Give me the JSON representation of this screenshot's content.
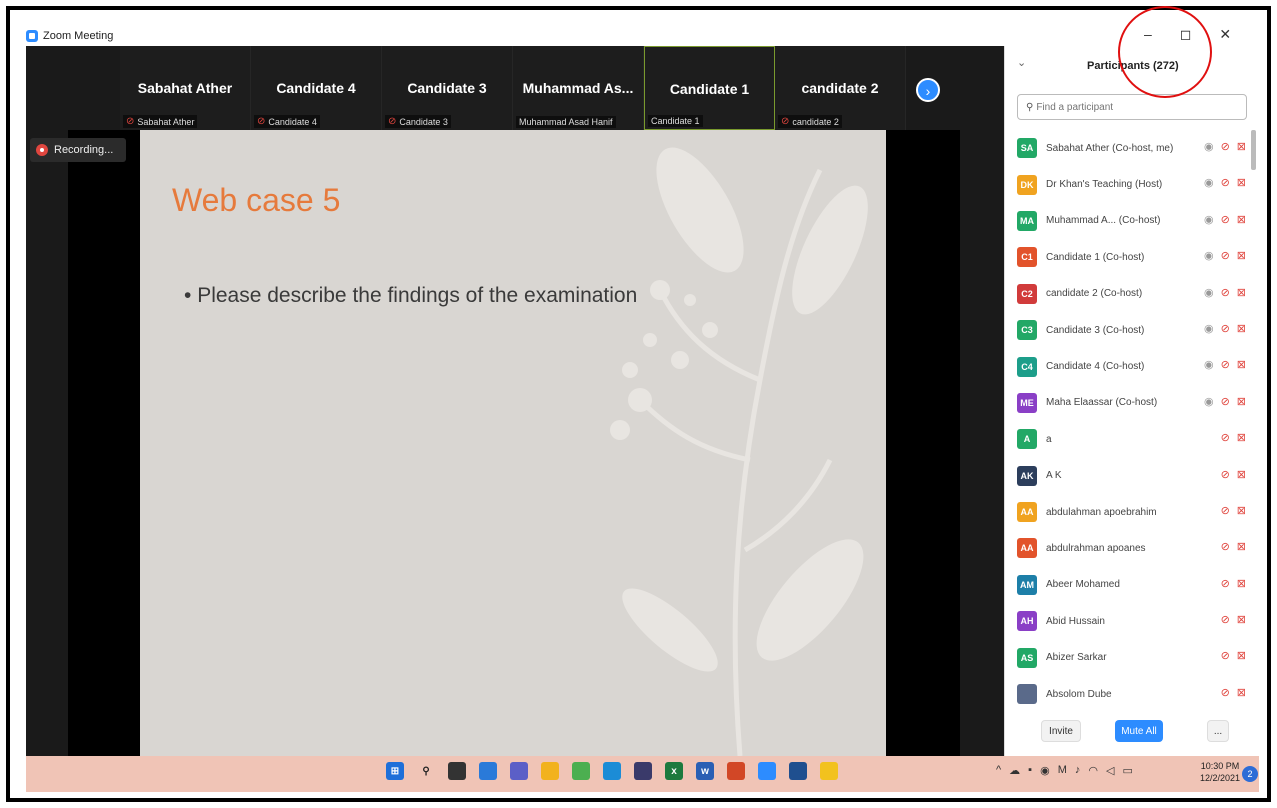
{
  "window": {
    "title": "Zoom Meeting",
    "controls": [
      "–",
      "◻",
      "✕"
    ]
  },
  "video_strip": {
    "tiles": [
      {
        "name": "Sabahat Ather",
        "sub": "Sabahat Ather",
        "muted": true
      },
      {
        "name": "Candidate 4",
        "sub": "Candidate 4",
        "muted": true
      },
      {
        "name": "Candidate 3",
        "sub": "Candidate 3",
        "muted": true
      },
      {
        "name": "Muhammad As...",
        "sub": "Muhammad Asad Hanif",
        "muted": false
      },
      {
        "name": "Candidate 1",
        "sub": "Candidate 1",
        "muted": false
      },
      {
        "name": "candidate 2",
        "sub": "candidate 2",
        "muted": true
      }
    ],
    "next_icon": "chevron-right-icon"
  },
  "recording": {
    "label": "Recording..."
  },
  "slide": {
    "title": "Web case 5",
    "bullet": "Please describe the findings of the examination"
  },
  "participants_panel": {
    "title": "Participants (272)",
    "search_placeholder": "Find a participant",
    "participants": [
      {
        "initials": "SA",
        "name": "Sabahat Ather (Co-host, me)",
        "color": "#22a866",
        "rec": true
      },
      {
        "initials": "DK",
        "name": "Dr Khan's Teaching (Host)",
        "color": "#f0a320",
        "rec": true
      },
      {
        "initials": "MA",
        "name": "Muhammad A... (Co-host)",
        "color": "#22a866",
        "rec": true
      },
      {
        "initials": "C1",
        "name": "Candidate 1 (Co-host)",
        "color": "#e2532b",
        "rec": true
      },
      {
        "initials": "C2",
        "name": "candidate 2 (Co-host)",
        "color": "#d13b3b",
        "rec": true
      },
      {
        "initials": "C3",
        "name": "Candidate 3 (Co-host)",
        "color": "#22a866",
        "rec": true
      },
      {
        "initials": "C4",
        "name": "Candidate 4 (Co-host)",
        "color": "#1d9e8a",
        "rec": true
      },
      {
        "initials": "ME",
        "name": "Maha Elaassar (Co-host)",
        "color": "#8a3fc6",
        "rec": true
      },
      {
        "initials": "A",
        "name": "a",
        "color": "#22a866",
        "rec": false
      },
      {
        "initials": "AK",
        "name": "A K",
        "color": "#2c3e5c",
        "rec": false
      },
      {
        "initials": "AA",
        "name": "abdulahman apoebrahim",
        "color": "#f0a320",
        "rec": false
      },
      {
        "initials": "AA",
        "name": "abdulrahman apoanes",
        "color": "#e2532b",
        "rec": false
      },
      {
        "initials": "AM",
        "name": "Abeer Mohamed",
        "color": "#1d7fa8",
        "rec": false
      },
      {
        "initials": "AH",
        "name": "Abid Hussain",
        "color": "#8a3fc6",
        "rec": false
      },
      {
        "initials": "AS",
        "name": "Abizer Sarkar",
        "color": "#22a866",
        "rec": false
      },
      {
        "initials": "",
        "name": "Absolom Dube",
        "color": "#5a6a8a",
        "rec": false
      }
    ],
    "footer": {
      "invite": "Invite",
      "mute_all": "Mute All",
      "more": "..."
    }
  },
  "taskbar": {
    "clock_time": "10:30 PM",
    "clock_date": "12/2/2021",
    "notifications": "2"
  }
}
